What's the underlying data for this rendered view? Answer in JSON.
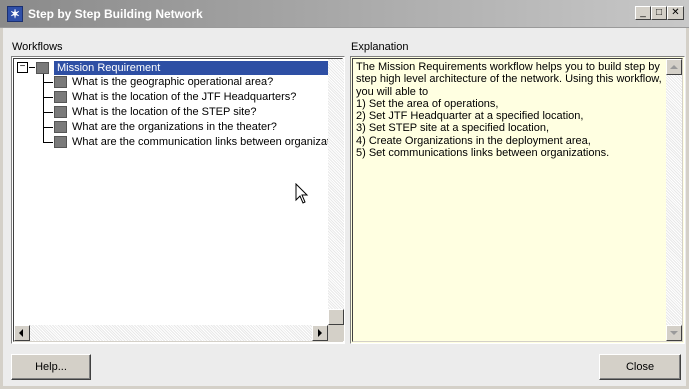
{
  "window": {
    "title": "Step by Step Building Network",
    "controls": [
      "minimize",
      "maximize",
      "close"
    ]
  },
  "workflows": {
    "label": "Workflows",
    "root": {
      "label": "Mission Requirement",
      "expanded": true,
      "selected": true
    },
    "items": [
      {
        "label": "What is the geographic operational area?"
      },
      {
        "label": "What is the location of the JTF Headquarters?"
      },
      {
        "label": "What is the location of the STEP site?"
      },
      {
        "label": "What are the organizations in the theater?"
      },
      {
        "label": "What are the communication links between organizat"
      }
    ]
  },
  "explanation": {
    "label": "Explanation",
    "text": "The Mission Requirements workflow helps you to build step by step high level architecture of the network. Using this workflow, you will able to\n1) Set the area of operations,\n2) Set JTF Headquarter at a specified location,\n3) Set STEP site at a specified location,\n4) Create Organizations in the deployment area,\n5) Set communications links between organizations."
  },
  "buttons": {
    "help": "Help...",
    "close": "Close"
  },
  "colors": {
    "selection": "#2e4fa4",
    "explanation_bg": "#ffffe1",
    "dialog_bg": "#ececec"
  }
}
